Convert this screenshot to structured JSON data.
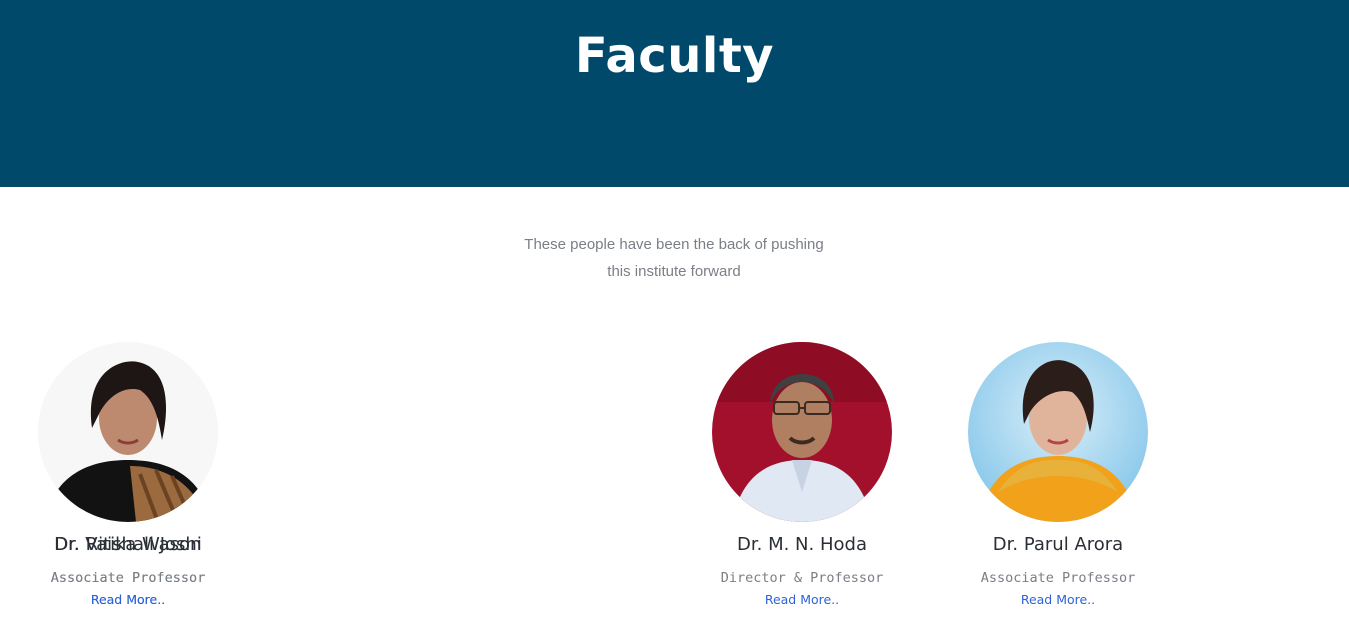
{
  "hero": {
    "title": "Faculty",
    "background": "#01496b"
  },
  "intro": {
    "line1": "These people have been the back of pushing",
    "line2": "this institute forward"
  },
  "faculty": [
    {
      "name": "Dr. M. N. Hoda",
      "role": "Director & Professor",
      "link": "Read More.."
    },
    {
      "name": "Dr. Parul Arora",
      "role": "Associate Professor",
      "link": "Read More.."
    },
    {
      "name": "Dr. Vaishali Joshi",
      "role": "Associate Professor",
      "link": "Read More.."
    },
    {
      "name": "Dr. Ritika Wason",
      "role": "Associate Professor",
      "link": "Read More.."
    }
  ],
  "colors": {
    "accent": "#2d63d8",
    "text": "#2a2f36",
    "muted": "#7a7f86"
  }
}
